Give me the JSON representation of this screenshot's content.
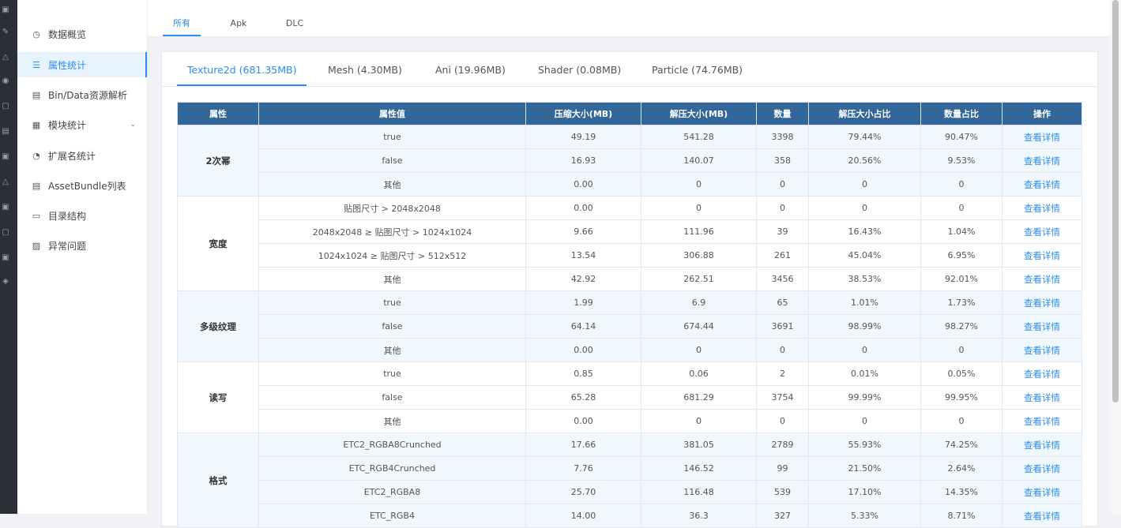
{
  "sidebar": {
    "items": [
      {
        "label": "数据概览",
        "icon": "dashboard-icon"
      },
      {
        "label": "属性统计",
        "icon": "list-icon",
        "active": true
      },
      {
        "label": "Bin/Data资源解析",
        "icon": "document-icon"
      },
      {
        "label": "模块统计",
        "icon": "grid-icon",
        "expandable": true
      },
      {
        "label": "扩展名统计",
        "icon": "pie-chart-icon"
      },
      {
        "label": "AssetBundle列表",
        "icon": "document-icon"
      },
      {
        "label": "目录结构",
        "icon": "folder-icon"
      },
      {
        "label": "异常问题",
        "icon": "warning-document-icon"
      }
    ]
  },
  "top_tabs": [
    {
      "label": "所有",
      "active": true
    },
    {
      "label": "Apk"
    },
    {
      "label": "DLC"
    }
  ],
  "sub_tabs": [
    {
      "label": "Texture2d (681.35MB)",
      "active": true
    },
    {
      "label": "Mesh (4.30MB)"
    },
    {
      "label": "Ani (19.96MB)"
    },
    {
      "label": "Shader (0.08MB)"
    },
    {
      "label": "Particle (74.76MB)"
    }
  ],
  "table": {
    "headers": [
      "属性",
      "属性值",
      "压缩大小(MB)",
      "解压大小(MB)",
      "数量",
      "解压大小占比",
      "数量占比",
      "操作"
    ],
    "action_label": "查看详情",
    "groups": [
      {
        "name": "2次幂",
        "rows": [
          [
            "true",
            "49.19",
            "541.28",
            "3398",
            "79.44%",
            "90.47%"
          ],
          [
            "false",
            "16.93",
            "140.07",
            "358",
            "20.56%",
            "9.53%"
          ],
          [
            "其他",
            "0.00",
            "0",
            "0",
            "0",
            "0"
          ]
        ]
      },
      {
        "name": "宽度",
        "rows": [
          [
            "贴图尺寸 > 2048x2048",
            "0.00",
            "0",
            "0",
            "0",
            "0"
          ],
          [
            "2048x2048 ≥ 贴图尺寸 > 1024x1024",
            "9.66",
            "111.96",
            "39",
            "16.43%",
            "1.04%"
          ],
          [
            "1024x1024 ≥ 贴图尺寸 > 512x512",
            "13.54",
            "306.88",
            "261",
            "45.04%",
            "6.95%"
          ],
          [
            "其他",
            "42.92",
            "262.51",
            "3456",
            "38.53%",
            "92.01%"
          ]
        ]
      },
      {
        "name": "多级纹理",
        "rows": [
          [
            "true",
            "1.99",
            "6.9",
            "65",
            "1.01%",
            "1.73%"
          ],
          [
            "false",
            "64.14",
            "674.44",
            "3691",
            "98.99%",
            "98.27%"
          ],
          [
            "其他",
            "0.00",
            "0",
            "0",
            "0",
            "0"
          ]
        ]
      },
      {
        "name": "读写",
        "rows": [
          [
            "true",
            "0.85",
            "0.06",
            "2",
            "0.01%",
            "0.05%"
          ],
          [
            "false",
            "65.28",
            "681.29",
            "3754",
            "99.99%",
            "99.95%"
          ],
          [
            "其他",
            "0.00",
            "0",
            "0",
            "0",
            "0"
          ]
        ]
      },
      {
        "name": "格式",
        "rows": [
          [
            "ETC2_RGBA8Crunched",
            "17.66",
            "381.05",
            "2789",
            "55.93%",
            "74.25%"
          ],
          [
            "ETC_RGB4Crunched",
            "7.76",
            "146.52",
            "99",
            "21.50%",
            "2.64%"
          ],
          [
            "ETC2_RGBA8",
            "25.70",
            "116.48",
            "539",
            "17.10%",
            "14.35%"
          ],
          [
            "ETC_RGB4",
            "14.00",
            "36.3",
            "327",
            "5.33%",
            "8.71%"
          ]
        ]
      }
    ]
  }
}
